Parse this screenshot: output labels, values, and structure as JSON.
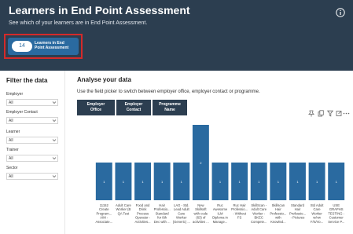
{
  "header": {
    "title": "Learners in End Point Assessment",
    "subtitle": "See which of your learners are in End Point Assessment.",
    "kpi": {
      "value": "14",
      "label_line1": "Learners in End",
      "label_line2": "Point Assessment"
    }
  },
  "filters": {
    "title": "Filter the data",
    "items": [
      {
        "label": "Employer",
        "value": "All"
      },
      {
        "label": "Employer Contact",
        "value": "All"
      },
      {
        "label": "Learner",
        "value": "All"
      },
      {
        "label": "Trainer",
        "value": "All"
      },
      {
        "label": "Sector",
        "value": "All"
      }
    ]
  },
  "main": {
    "title": "Analyse your data",
    "description": "Use the field picker to switch between employer office, employer contact or programme.",
    "tabs": [
      {
        "line1": "Employer",
        "line2": "Office"
      },
      {
        "line1": "Employer",
        "line2": "Contact"
      },
      {
        "line1": "Programme",
        "line2": "Name"
      }
    ]
  },
  "colors": {
    "header_bg": "#2c3e50",
    "kpi_bg": "#2a6aa0",
    "highlight": "#d42a2a",
    "bar": "#2a6aa0"
  },
  "chart_data": {
    "type": "bar",
    "ylim": [
      0,
      2
    ],
    "yticks": [
      "0",
      "1",
      "2"
    ],
    "categories": [
      [
        "11152",
        "Create",
        "Program...",
        "AIM -",
        "Associate..."
      ],
      [
        "Adult Care",
        "Worker (B",
        "QA Test"
      ],
      [
        "Food and",
        "Drink",
        "Process",
        "Operator -",
        "Activities..."
      ],
      [
        "Hair",
        "Professio...",
        "Standard",
        "for 8th",
        "Dec with ..."
      ],
      [
        "LAG - Std.",
        "Lead Adult",
        "Care",
        "Worker",
        "(Generic) ..."
      ],
      [
        "New",
        "Skillsoft",
        "with code",
        "(63) of",
        "activities ..."
      ],
      [
        "Ruc",
        "Awesome",
        "ILM",
        "Diploma in",
        "Manage..."
      ],
      [
        "Ruc Hair",
        "Professio...",
        "- Without",
        "FS"
      ],
      [
        "SkillScan -",
        "Adult Care",
        "Worker -",
        "BKEC",
        "Compete..."
      ],
      [
        "Skillscan",
        "Hair",
        "Professio...",
        "with",
        "Knowled..."
      ],
      [
        "Standard",
        "Hair",
        "Professio...",
        "- Pictures"
      ],
      [
        "Std Adult",
        "Care",
        "Worker",
        "w/nw",
        "F/S/Vo..."
      ],
      [
        "USE",
        "GRAPHS",
        "TESTING -",
        "Customer",
        "Service P..."
      ]
    ],
    "values": [
      1,
      1,
      1,
      1,
      1,
      2,
      1,
      1,
      1,
      1,
      1,
      1,
      1
    ],
    "data_labels": [
      "1",
      "1",
      "1",
      "1",
      "1",
      "2",
      "1",
      "1",
      "1",
      "1",
      "1",
      "1",
      "1"
    ]
  }
}
